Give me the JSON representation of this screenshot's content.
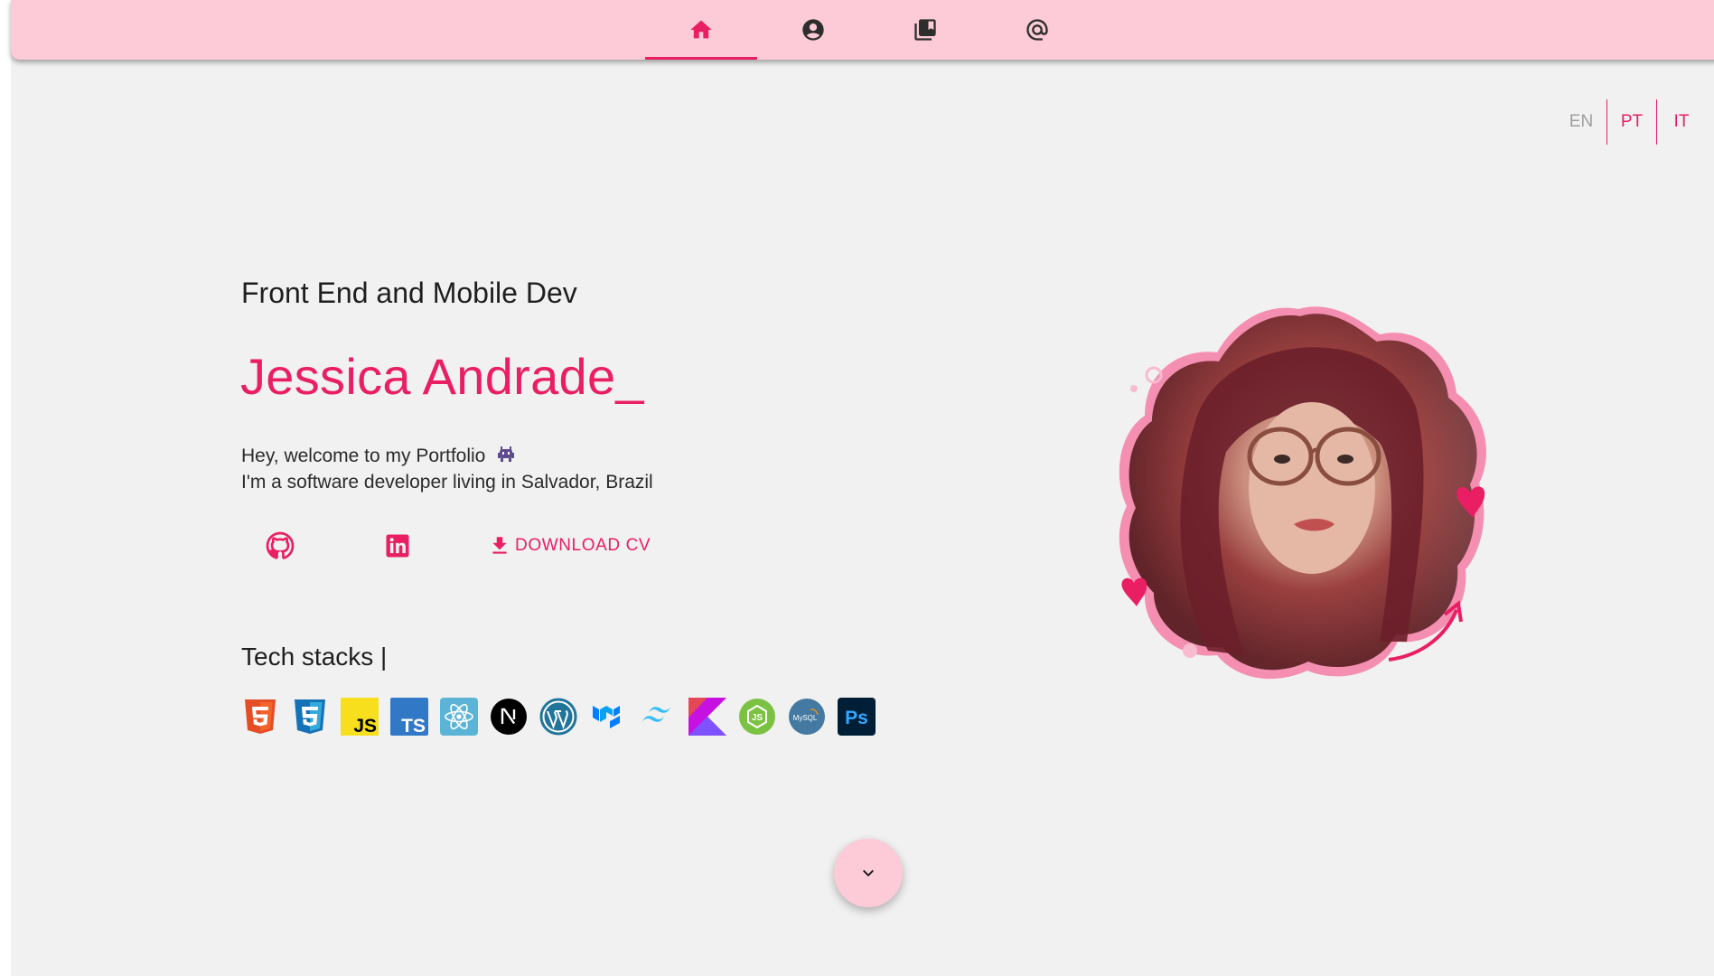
{
  "nav": {
    "tabs": [
      {
        "icon": "home-icon",
        "active": true
      },
      {
        "icon": "user-circle-icon",
        "active": false
      },
      {
        "icon": "library-books-icon",
        "active": false
      },
      {
        "icon": "at-sign-icon",
        "active": false
      }
    ]
  },
  "languages": {
    "en": "EN",
    "pt": "PT",
    "it": "IT",
    "active": "EN"
  },
  "hero": {
    "subtitle": "Front End and Mobile Dev",
    "name": "Jessica Andrade_",
    "intro_line1": "Hey, welcome to my Portfolio",
    "intro_line2": "I'm a software developer living in Salvador, Brazil",
    "emoji_icon": "alien-monster-icon"
  },
  "social": {
    "github_icon": "github-icon",
    "linkedin_icon": "linkedin-icon",
    "download_label": "DOWNLOAD CV",
    "download_icon": "download-icon"
  },
  "tech": {
    "title": "Tech stacks |",
    "stack": [
      "html5",
      "css3",
      "javascript",
      "typescript",
      "react",
      "nextjs",
      "wordpress",
      "material-ui",
      "tailwind",
      "kotlin",
      "nodejs",
      "mysql",
      "photoshop"
    ],
    "labels": {
      "javascript": "JS",
      "typescript": "TS",
      "photoshop": "Ps",
      "mysql": "MySQL"
    }
  },
  "colors": {
    "accent": "#e91e63",
    "nav_bg": "#fccbd7",
    "page_bg": "#f1f1f1",
    "inactive_lang": "#9e9e9e"
  },
  "scroll": {
    "icon": "chevron-down-icon"
  }
}
